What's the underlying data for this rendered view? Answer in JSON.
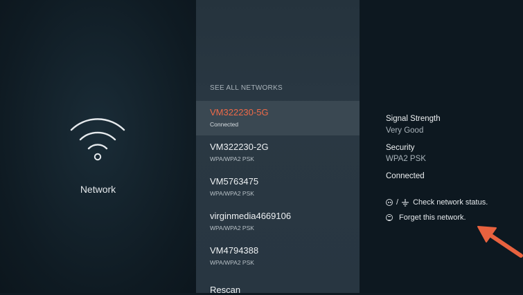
{
  "left": {
    "title": "Network",
    "icon": "wifi-icon"
  },
  "networks": {
    "header": "SEE ALL NETWORKS",
    "items": [
      {
        "name": "VM322230-5G",
        "status": "Connected",
        "selected": true
      },
      {
        "name": "VM322230-2G",
        "status": "WPA/WPA2 PSK",
        "selected": false
      },
      {
        "name": "VM5763475",
        "status": "WPA/WPA2 PSK",
        "selected": false
      },
      {
        "name": "virginmedia4669106",
        "status": "WPA/WPA2 PSK",
        "selected": false
      },
      {
        "name": "VM4794388",
        "status": "WPA/WPA2 PSK",
        "selected": false
      }
    ],
    "rescan": "Rescan"
  },
  "details": {
    "signal_label": "Signal Strength",
    "signal_value": "Very Good",
    "security_label": "Security",
    "security_value": "WPA2 PSK",
    "connection_status": "Connected",
    "hint_status_separator": "/",
    "hint_status": "Check network status.",
    "hint_forget": "Forget this network."
  },
  "colors": {
    "accent": "#ef6a48",
    "arrow": "#e8623f"
  }
}
